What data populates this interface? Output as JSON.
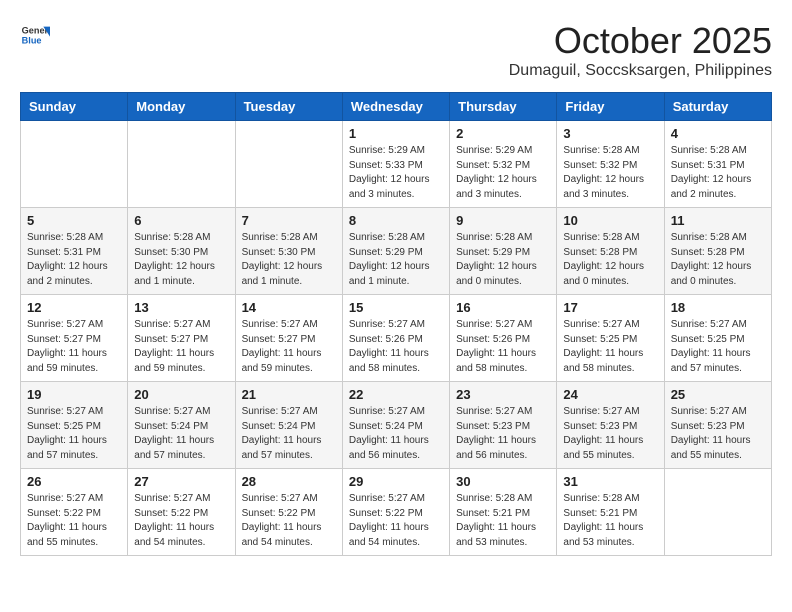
{
  "header": {
    "logo": {
      "line1": "General",
      "line2": "Blue"
    },
    "month": "October 2025",
    "location": "Dumaguil, Soccsksargen, Philippines"
  },
  "weekdays": [
    "Sunday",
    "Monday",
    "Tuesday",
    "Wednesday",
    "Thursday",
    "Friday",
    "Saturday"
  ],
  "weeks": [
    [
      {
        "day": "",
        "info": ""
      },
      {
        "day": "",
        "info": ""
      },
      {
        "day": "",
        "info": ""
      },
      {
        "day": "1",
        "info": "Sunrise: 5:29 AM\nSunset: 5:33 PM\nDaylight: 12 hours\nand 3 minutes."
      },
      {
        "day": "2",
        "info": "Sunrise: 5:29 AM\nSunset: 5:32 PM\nDaylight: 12 hours\nand 3 minutes."
      },
      {
        "day": "3",
        "info": "Sunrise: 5:28 AM\nSunset: 5:32 PM\nDaylight: 12 hours\nand 3 minutes."
      },
      {
        "day": "4",
        "info": "Sunrise: 5:28 AM\nSunset: 5:31 PM\nDaylight: 12 hours\nand 2 minutes."
      }
    ],
    [
      {
        "day": "5",
        "info": "Sunrise: 5:28 AM\nSunset: 5:31 PM\nDaylight: 12 hours\nand 2 minutes."
      },
      {
        "day": "6",
        "info": "Sunrise: 5:28 AM\nSunset: 5:30 PM\nDaylight: 12 hours\nand 1 minute."
      },
      {
        "day": "7",
        "info": "Sunrise: 5:28 AM\nSunset: 5:30 PM\nDaylight: 12 hours\nand 1 minute."
      },
      {
        "day": "8",
        "info": "Sunrise: 5:28 AM\nSunset: 5:29 PM\nDaylight: 12 hours\nand 1 minute."
      },
      {
        "day": "9",
        "info": "Sunrise: 5:28 AM\nSunset: 5:29 PM\nDaylight: 12 hours\nand 0 minutes."
      },
      {
        "day": "10",
        "info": "Sunrise: 5:28 AM\nSunset: 5:28 PM\nDaylight: 12 hours\nand 0 minutes."
      },
      {
        "day": "11",
        "info": "Sunrise: 5:28 AM\nSunset: 5:28 PM\nDaylight: 12 hours\nand 0 minutes."
      }
    ],
    [
      {
        "day": "12",
        "info": "Sunrise: 5:27 AM\nSunset: 5:27 PM\nDaylight: 11 hours\nand 59 minutes."
      },
      {
        "day": "13",
        "info": "Sunrise: 5:27 AM\nSunset: 5:27 PM\nDaylight: 11 hours\nand 59 minutes."
      },
      {
        "day": "14",
        "info": "Sunrise: 5:27 AM\nSunset: 5:27 PM\nDaylight: 11 hours\nand 59 minutes."
      },
      {
        "day": "15",
        "info": "Sunrise: 5:27 AM\nSunset: 5:26 PM\nDaylight: 11 hours\nand 58 minutes."
      },
      {
        "day": "16",
        "info": "Sunrise: 5:27 AM\nSunset: 5:26 PM\nDaylight: 11 hours\nand 58 minutes."
      },
      {
        "day": "17",
        "info": "Sunrise: 5:27 AM\nSunset: 5:25 PM\nDaylight: 11 hours\nand 58 minutes."
      },
      {
        "day": "18",
        "info": "Sunrise: 5:27 AM\nSunset: 5:25 PM\nDaylight: 11 hours\nand 57 minutes."
      }
    ],
    [
      {
        "day": "19",
        "info": "Sunrise: 5:27 AM\nSunset: 5:25 PM\nDaylight: 11 hours\nand 57 minutes."
      },
      {
        "day": "20",
        "info": "Sunrise: 5:27 AM\nSunset: 5:24 PM\nDaylight: 11 hours\nand 57 minutes."
      },
      {
        "day": "21",
        "info": "Sunrise: 5:27 AM\nSunset: 5:24 PM\nDaylight: 11 hours\nand 57 minutes."
      },
      {
        "day": "22",
        "info": "Sunrise: 5:27 AM\nSunset: 5:24 PM\nDaylight: 11 hours\nand 56 minutes."
      },
      {
        "day": "23",
        "info": "Sunrise: 5:27 AM\nSunset: 5:23 PM\nDaylight: 11 hours\nand 56 minutes."
      },
      {
        "day": "24",
        "info": "Sunrise: 5:27 AM\nSunset: 5:23 PM\nDaylight: 11 hours\nand 55 minutes."
      },
      {
        "day": "25",
        "info": "Sunrise: 5:27 AM\nSunset: 5:23 PM\nDaylight: 11 hours\nand 55 minutes."
      }
    ],
    [
      {
        "day": "26",
        "info": "Sunrise: 5:27 AM\nSunset: 5:22 PM\nDaylight: 11 hours\nand 55 minutes."
      },
      {
        "day": "27",
        "info": "Sunrise: 5:27 AM\nSunset: 5:22 PM\nDaylight: 11 hours\nand 54 minutes."
      },
      {
        "day": "28",
        "info": "Sunrise: 5:27 AM\nSunset: 5:22 PM\nDaylight: 11 hours\nand 54 minutes."
      },
      {
        "day": "29",
        "info": "Sunrise: 5:27 AM\nSunset: 5:22 PM\nDaylight: 11 hours\nand 54 minutes."
      },
      {
        "day": "30",
        "info": "Sunrise: 5:28 AM\nSunset: 5:21 PM\nDaylight: 11 hours\nand 53 minutes."
      },
      {
        "day": "31",
        "info": "Sunrise: 5:28 AM\nSunset: 5:21 PM\nDaylight: 11 hours\nand 53 minutes."
      },
      {
        "day": "",
        "info": ""
      }
    ]
  ]
}
